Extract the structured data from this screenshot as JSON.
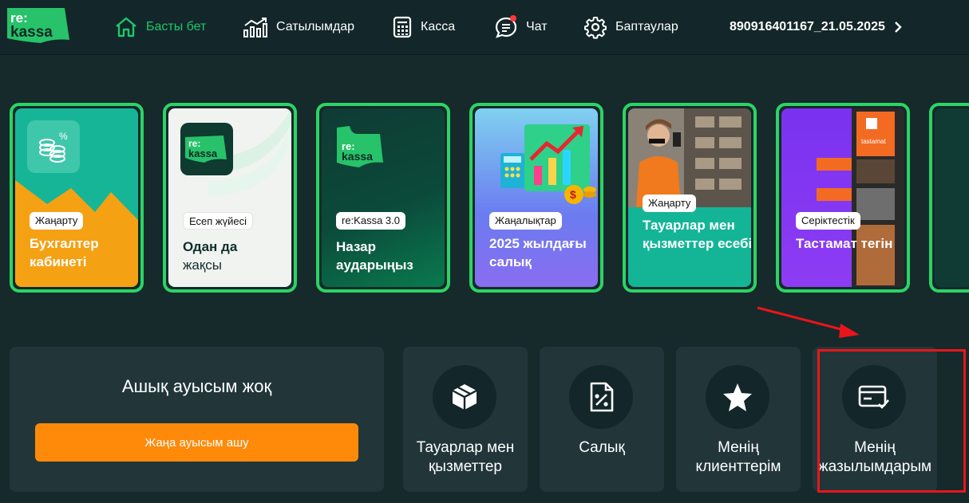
{
  "logo": {
    "line1": "re:",
    "line2": "kassa"
  },
  "nav": {
    "home": "Басты бет",
    "sales": "Сатылымдар",
    "cash": "Касса",
    "chat": "Чат",
    "settings": "Баптаулар",
    "account": "890916401167_21.05.2025"
  },
  "cards": [
    {
      "badge": "Жаңарту",
      "title": "Бухгалтер кабинеті"
    },
    {
      "badge": "Есеп жүйесі",
      "title": "Одан да",
      "subtitle": "жақсы"
    },
    {
      "badge": "re:Kassa 3.0",
      "title": "Назар аударыңыз"
    },
    {
      "badge": "Жаңалықтар",
      "title": "2025 жылдағы салық"
    },
    {
      "badge": "Жаңарту",
      "title": "Тауарлар мен қызметтер есебі"
    },
    {
      "badge": "Серіктестік",
      "title": "Тастамат тегін",
      "brand": "tastamat"
    }
  ],
  "shift": {
    "title": "Ашық ауысым жоқ",
    "button": "Жаңа ауысым ашу"
  },
  "tiles": [
    {
      "label": "Тауарлар мен қызметтер",
      "icon": "box-icon"
    },
    {
      "label": "Салық",
      "icon": "tax-document-icon"
    },
    {
      "label": "Менің клиенттерім",
      "icon": "star-icon"
    },
    {
      "label": "Менің жазылымдарым",
      "icon": "subscription-card-icon"
    }
  ],
  "colors": {
    "accent": "#1fc66b",
    "card_border": "#2bd464",
    "primary_button": "#ff8a0a",
    "highlight": "#e8161a"
  }
}
